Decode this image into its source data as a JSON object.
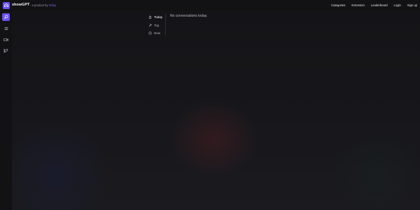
{
  "header": {
    "brand": "showGPT",
    "tagline_prefix": "- a product by",
    "tagline_company": "Shiny",
    "nav": [
      "Categories",
      "Extension",
      "Leaderboard",
      "Login",
      "Sign up"
    ]
  },
  "sidebar": {
    "items": [
      {
        "icon": "explore-icon",
        "active": true
      },
      {
        "icon": "list-icon",
        "active": false
      },
      {
        "icon": "video-icon",
        "active": false
      },
      {
        "icon": "twitter-icon",
        "active": false
      }
    ]
  },
  "tabs": [
    {
      "label": "Today",
      "icon": "flame-icon",
      "active": true
    },
    {
      "label": "Top",
      "icon": "arrow-up-icon",
      "active": false
    },
    {
      "label": "New",
      "icon": "clock-icon",
      "active": false
    }
  ],
  "main": {
    "empty_message": "No conversations today."
  },
  "colors": {
    "accent": "#6d50f2",
    "background": "#131316",
    "bar": "#121214"
  }
}
